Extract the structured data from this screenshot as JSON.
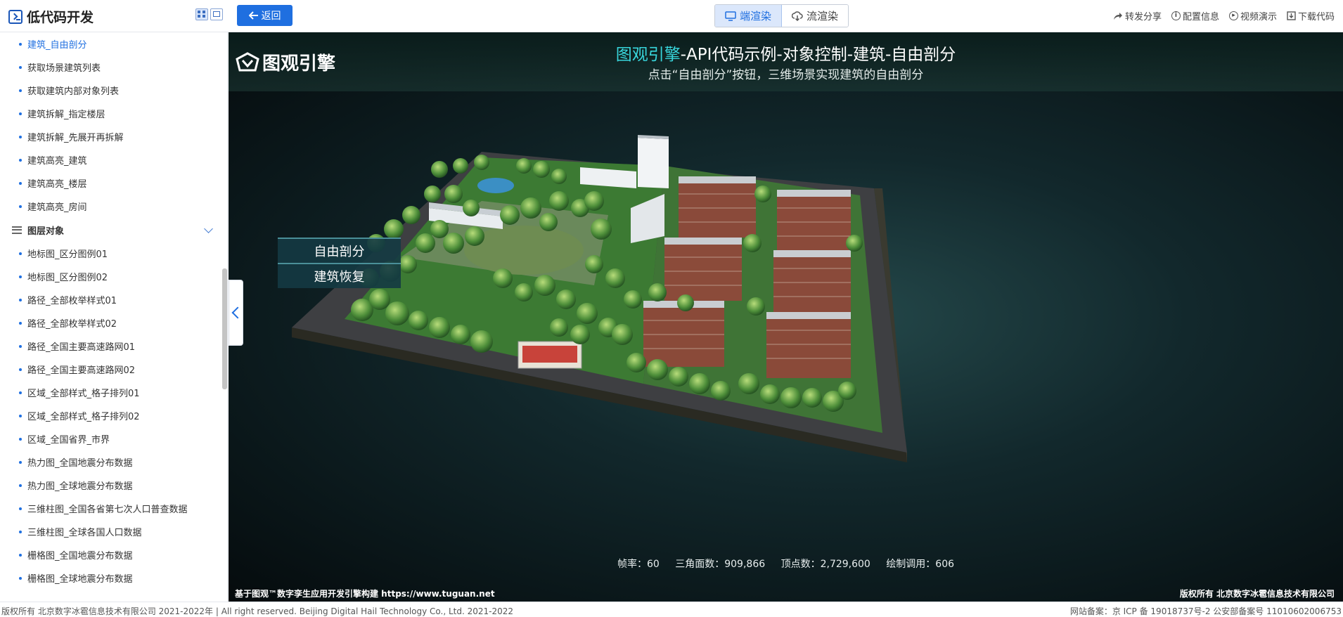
{
  "app": {
    "title": "低代码开发"
  },
  "toolbar": {
    "back_label": "返回"
  },
  "render_tabs": [
    {
      "label": "端渲染",
      "active": true
    },
    {
      "label": "流渲染",
      "active": false
    }
  ],
  "top_actions": [
    {
      "label": "转发分享",
      "icon": "share-icon"
    },
    {
      "label": "配置信息",
      "icon": "info-icon"
    },
    {
      "label": "视频演示",
      "icon": "play-icon"
    },
    {
      "label": "下载代码",
      "icon": "download-icon"
    }
  ],
  "sidebar": {
    "items_top": [
      {
        "label": "建筑_自由剖分",
        "active": true
      },
      {
        "label": "获取场景建筑列表"
      },
      {
        "label": "获取建筑内部对象列表"
      },
      {
        "label": "建筑拆解_指定楼层"
      },
      {
        "label": "建筑拆解_先展开再拆解"
      },
      {
        "label": "建筑高亮_建筑"
      },
      {
        "label": "建筑高亮_楼层"
      },
      {
        "label": "建筑高亮_房间"
      }
    ],
    "group_label": "图层对象",
    "items_group": [
      {
        "label": "地标图_区分图例01"
      },
      {
        "label": "地标图_区分图例02"
      },
      {
        "label": "路径_全部枚举样式01"
      },
      {
        "label": "路径_全部枚举样式02"
      },
      {
        "label": "路径_全国主要高速路网01"
      },
      {
        "label": "路径_全国主要高速路网02"
      },
      {
        "label": "区域_全部样式_格子排列01"
      },
      {
        "label": "区域_全部样式_格子排列02"
      },
      {
        "label": "区域_全国省界_市界"
      },
      {
        "label": "热力图_全国地震分布数据"
      },
      {
        "label": "热力图_全球地震分布数据"
      },
      {
        "label": "三维柱图_全国各省第七次人口普查数据"
      },
      {
        "label": "三维柱图_全球各国人口数据"
      },
      {
        "label": "栅格图_全国地震分布数据"
      },
      {
        "label": "栅格图_全球地震分布数据"
      }
    ]
  },
  "viewport": {
    "logo_text": "图观引擎",
    "title_highlight": "图观引擎",
    "title_rest": "-API代码示例-对象控制-建筑-自由剖分",
    "subtitle": "点击“自由剖分”按钮，三维场景实现建筑的自由剖分",
    "buttons": {
      "split": "自由剖分",
      "restore": "建筑恢复"
    },
    "stats": {
      "fps": "帧率：60",
      "triangles": "三角面数：909,866",
      "vertices": "顶点数：2,729,600",
      "draw_calls": "绘制调用：606"
    },
    "footer_left": "基于图观™数字孪生应用开发引擎构建 https://www.tuguan.net",
    "footer_right": "版权所有 北京数字冰雹信息技术有限公司"
  },
  "page_footer": {
    "left": "版权所有 北京数字冰雹信息技术有限公司 2021-2022年 | All right reserved. Beijing Digital Hail Technology Co., Ltd. 2021-2022",
    "right": "网站备案：京 ICP 备 19018737号-2 公安部备案号 11010602006753"
  },
  "colors": {
    "accent": "#1f6fe0",
    "title_highlight": "#38d6dc",
    "scene_bg": "#0b1a1c"
  }
}
